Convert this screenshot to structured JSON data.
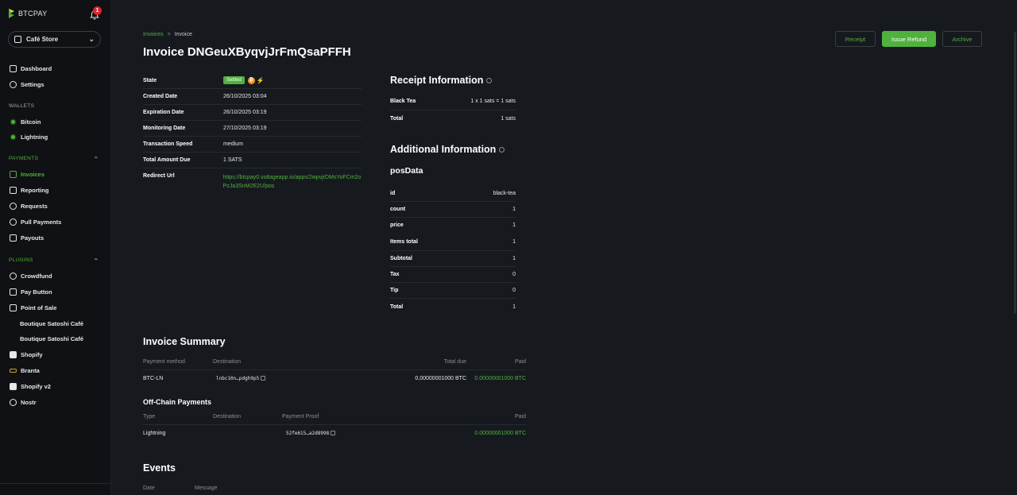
{
  "sidebar": {
    "logo": "BTCPAY",
    "notifications": "1",
    "store": "Café Store",
    "dashboard": "Dashboard",
    "settings": "Settings",
    "wallets_header": "WALLETS",
    "bitcoin": "Bitcoin",
    "lightning": "Lightning",
    "payments_header": "PAYMENTS",
    "invoices": "Invoices",
    "reporting": "Reporting",
    "requests": "Requests",
    "pull_payments": "Pull Payments",
    "payouts": "Payouts",
    "plugins_header": "PLUGINS",
    "crowdfund": "Crowdfund",
    "pay_button": "Pay Button",
    "point_of_sale": "Point of Sale",
    "pos_app_1": "Boutique Satoshi Café",
    "pos_app_2": "Boutique Satoshi Café",
    "shopify": "Shopify",
    "branta": "Branta",
    "shopify_v2": "Shopify v2",
    "nostr": "Nostr"
  },
  "breadcrumb": {
    "parent": "Invoices",
    "sep": ">",
    "current": "Invoice"
  },
  "title": "Invoice DNGeuXByqvjJrFmQsaPFFH",
  "actions": {
    "receipt": "Receipt",
    "refund": "Issue Refund",
    "archive": "Archive"
  },
  "details": {
    "state_label": "State",
    "state_value": "Settled",
    "created_label": "Created Date",
    "created_value": "26/10/2025 03:04",
    "expiration_label": "Expiration Date",
    "expiration_value": "26/10/2025 03:19",
    "monitoring_label": "Monitoring Date",
    "monitoring_value": "27/10/2025 03:19",
    "speed_label": "Transaction Speed",
    "speed_value": "medium",
    "due_label": "Total Amount Due",
    "due_value": "1 SATS",
    "redirect_label": "Redirect Url",
    "redirect_value": "https://btcpay0.voltageapp.io/apps/2wpvjrDMsYoFCm2oPzJa3SnM2E2U/pos"
  },
  "receipt": {
    "title": "Receipt Information",
    "item_label": "Black Tea",
    "item_value": "1 x 1 sats = 1 sats",
    "total_label": "Total",
    "total_value": "1 sats"
  },
  "additional": {
    "title": "Additional Information",
    "subtitle": "posData",
    "id_label": "id",
    "id_value": "black-tea",
    "count_label": "count",
    "count_value": "1",
    "price_label": "price",
    "price_value": "1",
    "items_total_label": "Items total",
    "items_total_value": "1",
    "subtotal_label": "Subtotal",
    "subtotal_value": "1",
    "tax_label": "Tax",
    "tax_value": "0",
    "tip_label": "Tip",
    "tip_value": "0",
    "total_label": "Total",
    "total_value": "1"
  },
  "summary": {
    "title": "Invoice Summary",
    "h_method": "Payment method",
    "h_dest": "Destination",
    "h_due": "Total due",
    "h_paid": "Paid",
    "method": "BTC-LN",
    "dest": "lnbc10n…pdgh9p5",
    "due": "0,00000001000 BTC",
    "paid": "0.00000001000 BTC"
  },
  "offchain": {
    "title": "Off-Chain Payments",
    "h_type": "Type",
    "h_dest": "Destination",
    "h_proof": "Payment Proof",
    "h_paid": "Paid",
    "type": "Lightning",
    "proof": "52fe615…a2d8998",
    "paid": "0.00000001000 BTC"
  },
  "events": {
    "title": "Events",
    "h_date": "Date",
    "h_message": "Message"
  }
}
